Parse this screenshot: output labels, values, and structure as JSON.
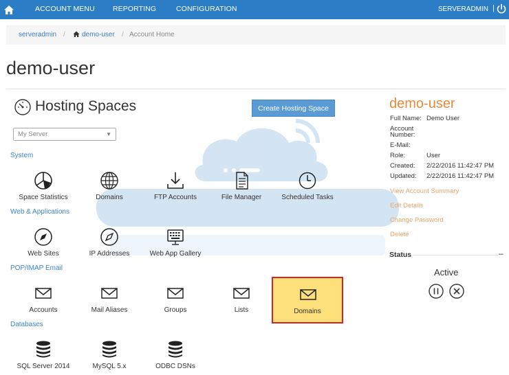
{
  "nav": {
    "items": [
      "ACCOUNT MENU",
      "REPORTING",
      "CONFIGURATION"
    ],
    "user": "SERVERADMIN",
    "separator": "|"
  },
  "breadcrumb": {
    "root": "serveradmin",
    "sep1": "/",
    "user": "demo-user",
    "sep2": "/",
    "current": "Account Home"
  },
  "page_title": "demo-user",
  "hosting": {
    "title": "Hosting Spaces",
    "create_button": "Create Hosting Space",
    "selected_server": "My Server"
  },
  "sections": {
    "system": "System",
    "web": "Web & Applications",
    "email": "POP/IMAP Email",
    "databases": "Databases"
  },
  "tiles": {
    "system": [
      "Space Statistics",
      "Domains",
      "FTP Accounts",
      "File Manager",
      "Scheduled Tasks"
    ],
    "web": [
      "Web Sites",
      "IP Addresses",
      "Web App Gallery"
    ],
    "email": [
      "Accounts",
      "Mail Aliases",
      "Groups",
      "Lists",
      "Domains"
    ],
    "databases": [
      "SQL Server 2014",
      "MySQL 5.x",
      "ODBC DSNs"
    ]
  },
  "account": {
    "name": "demo-user",
    "full_name_label": "Full Name:",
    "full_name": "Demo User",
    "account_number_label_1": "Account",
    "account_number_label_2": "Number:",
    "email_label": "E-Mail:",
    "role_label": "Role:",
    "role": "User",
    "created_label": "Created:",
    "created": "2/22/2016 11:42:47 PM",
    "updated_label": "Updated:",
    "updated": "2/22/2016 11:42:47 PM",
    "links": [
      "View Account Summary",
      "Edit Details",
      "Change Password",
      "Delete"
    ],
    "status_label": "Status",
    "status_toggle": "–",
    "status": "Active"
  },
  "colors": {
    "nav_bg": "#2b7dc6",
    "accent_orange": "#e58a3a",
    "highlight_fill": "#fde07b",
    "highlight_border": "#d42323",
    "link_blue": "#3a7fc1"
  }
}
